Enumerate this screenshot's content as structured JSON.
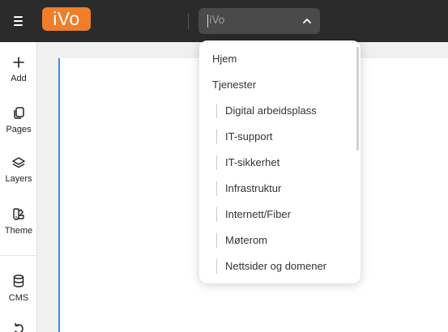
{
  "topbar": {
    "logo_text": "iVo",
    "page_select_value": "iVo"
  },
  "sidebar": {
    "items": [
      {
        "label": "Add",
        "icon": "plus-icon"
      },
      {
        "label": "Pages",
        "icon": "pages-icon"
      },
      {
        "label": "Layers",
        "icon": "layers-icon"
      },
      {
        "label": "Theme",
        "icon": "theme-icon"
      },
      {
        "label": "CMS",
        "icon": "database-icon"
      }
    ]
  },
  "dropdown": {
    "items": [
      {
        "label": "Hjem",
        "level": 0
      },
      {
        "label": "Tjenester",
        "level": 0
      },
      {
        "label": "Digital arbeidsplass",
        "level": 1
      },
      {
        "label": "IT-support",
        "level": 1
      },
      {
        "label": "IT-sikkerhet",
        "level": 1
      },
      {
        "label": "Infrastruktur",
        "level": 1
      },
      {
        "label": "Internett/Fiber",
        "level": 1
      },
      {
        "label": "Møterom",
        "level": 1
      },
      {
        "label": "Nettsider og domener",
        "level": 1
      }
    ]
  },
  "colors": {
    "topbar": "#2b2b2b",
    "logo": "#f07d2a",
    "select_bg": "#4a4a4a",
    "selection_outline": "#3b8dea"
  }
}
